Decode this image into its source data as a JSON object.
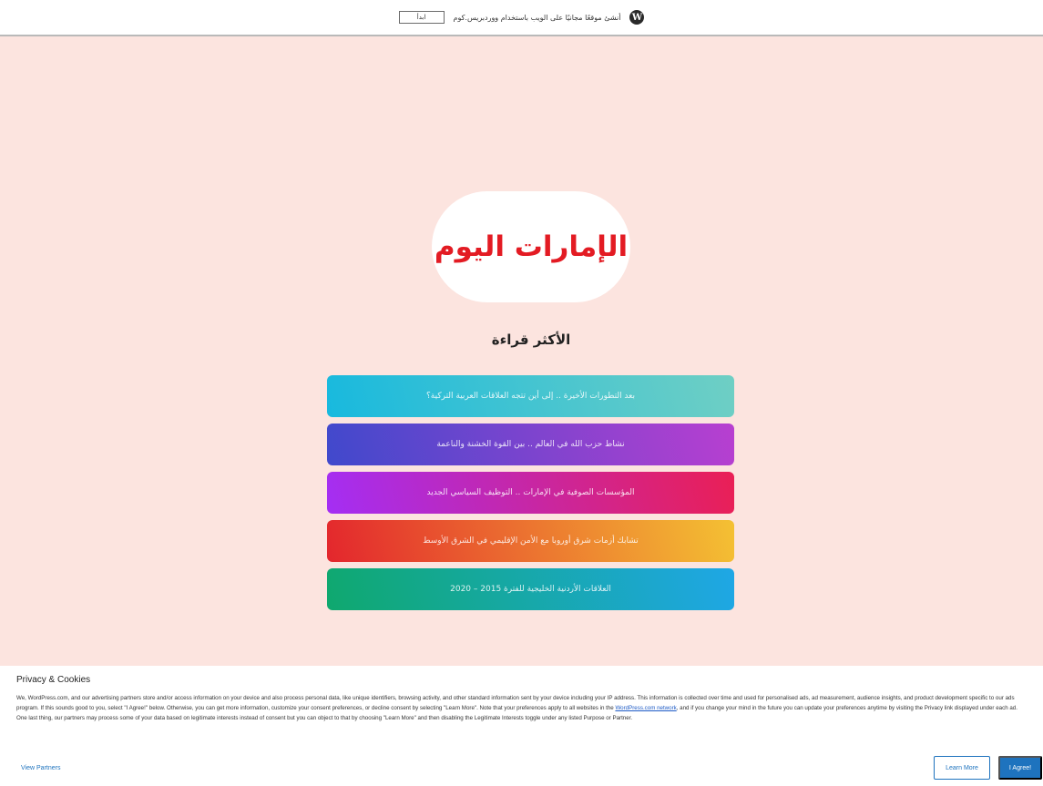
{
  "topbar": {
    "promo_text": "أنشئ موقعًا مجانيًا على الويب باستخدام ووردبريس.كوم",
    "start_label": "ابدأ",
    "logo_icon": "wordpress-logo-icon"
  },
  "site": {
    "logo_text": "الإمارات اليوم"
  },
  "most_read": {
    "title": "الأكثر قراءة",
    "articles": [
      {
        "title": "بعد التطورات الأخيرة .. إلى أين تتجه العلاقات العربية التركية؟",
        "gradient_from": "#18b9de",
        "gradient_to": "#6fcfc4"
      },
      {
        "title": "نشاط حزب الله في العالم .. بين القوة الخشنة والناعمة",
        "gradient_from": "#4049cc",
        "gradient_to": "#b83fd0"
      },
      {
        "title": "المؤسسات الصوفية في الإمارات .. التوظيف السياسي الجديد",
        "gradient_from": "#a42ef4",
        "gradient_to": "#ea1f55"
      },
      {
        "title": "تشابك أزمات شرق أوروبا مع الأمن الإقليمي في الشرق الأوسط",
        "gradient_from": "#e3262d",
        "gradient_to": "#f4c133"
      },
      {
        "title": "العلاقات الأردنية الخليجية للفترة 2015 – 2020",
        "gradient_from": "#0fa86e",
        "gradient_to": "#1fa7e6"
      }
    ]
  },
  "cookie_banner": {
    "title": "Privacy & Cookies",
    "body_part1": "We, WordPress.com, and our advertising partners store and/or access information on your device and also process personal data, like unique identifiers, browsing activity, and other standard information sent by your device including your IP address. This information is collected over time and used for personalised ads, ad measurement, audience insights, and product development specific to our ads program. If this sounds good to you, select \"I Agree!\" below. Otherwise, you can get more information, customize your consent preferences, or decline consent by selecting \"Learn More\". Note that your preferences apply to all websites in the ",
    "link_text": "WordPress.com network",
    "body_part2": ", and if you change your mind in the future you can update your preferences anytime by visiting the Privacy link displayed under each ad. One last thing, our partners may process some of your data based on legitimate interests instead of consent but you can object to that by choosing \"Learn More\" and then disabling the Legitimate Interests toggle under any listed Purpose or Partner.",
    "view_partners_label": "View Partners",
    "learn_more_label": "Learn More",
    "agree_label": "I Agree!"
  }
}
